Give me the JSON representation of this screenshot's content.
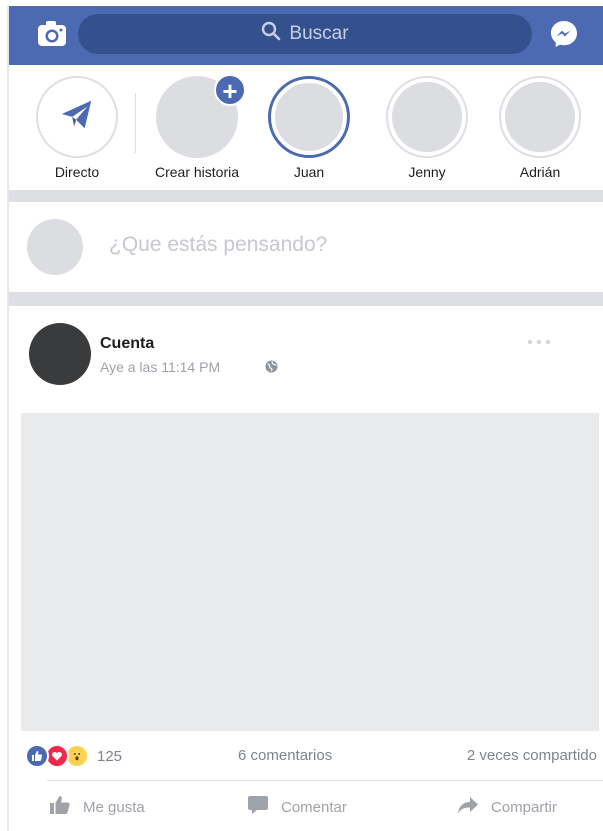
{
  "header": {
    "camera_icon": "camera-icon",
    "search_placeholder": "Buscar",
    "messenger_icon": "messenger-icon",
    "brand_color": "#4b6ab1"
  },
  "stories": {
    "items": [
      {
        "label": "Directo",
        "icon": "paper-plane-icon"
      },
      {
        "label": "Crear historia",
        "icon": "plus-icon"
      },
      {
        "label": "Juan"
      },
      {
        "label": "Jenny"
      },
      {
        "label": "Adrián"
      }
    ]
  },
  "composer": {
    "prompt": "¿Que estás pensando?"
  },
  "post": {
    "author": "Cuenta",
    "timestamp": "Aye a las 11:14 PM",
    "privacy_icon": "globe-icon",
    "more_icon": "more-dots-icon",
    "reactions": {
      "types": [
        "like",
        "love",
        "wow"
      ],
      "count": "125"
    },
    "comments": "6 comentarios",
    "shares": "2 veces compartido",
    "actions": {
      "like": "Me gusta",
      "comment": "Comentar",
      "share": "Compartir"
    }
  }
}
